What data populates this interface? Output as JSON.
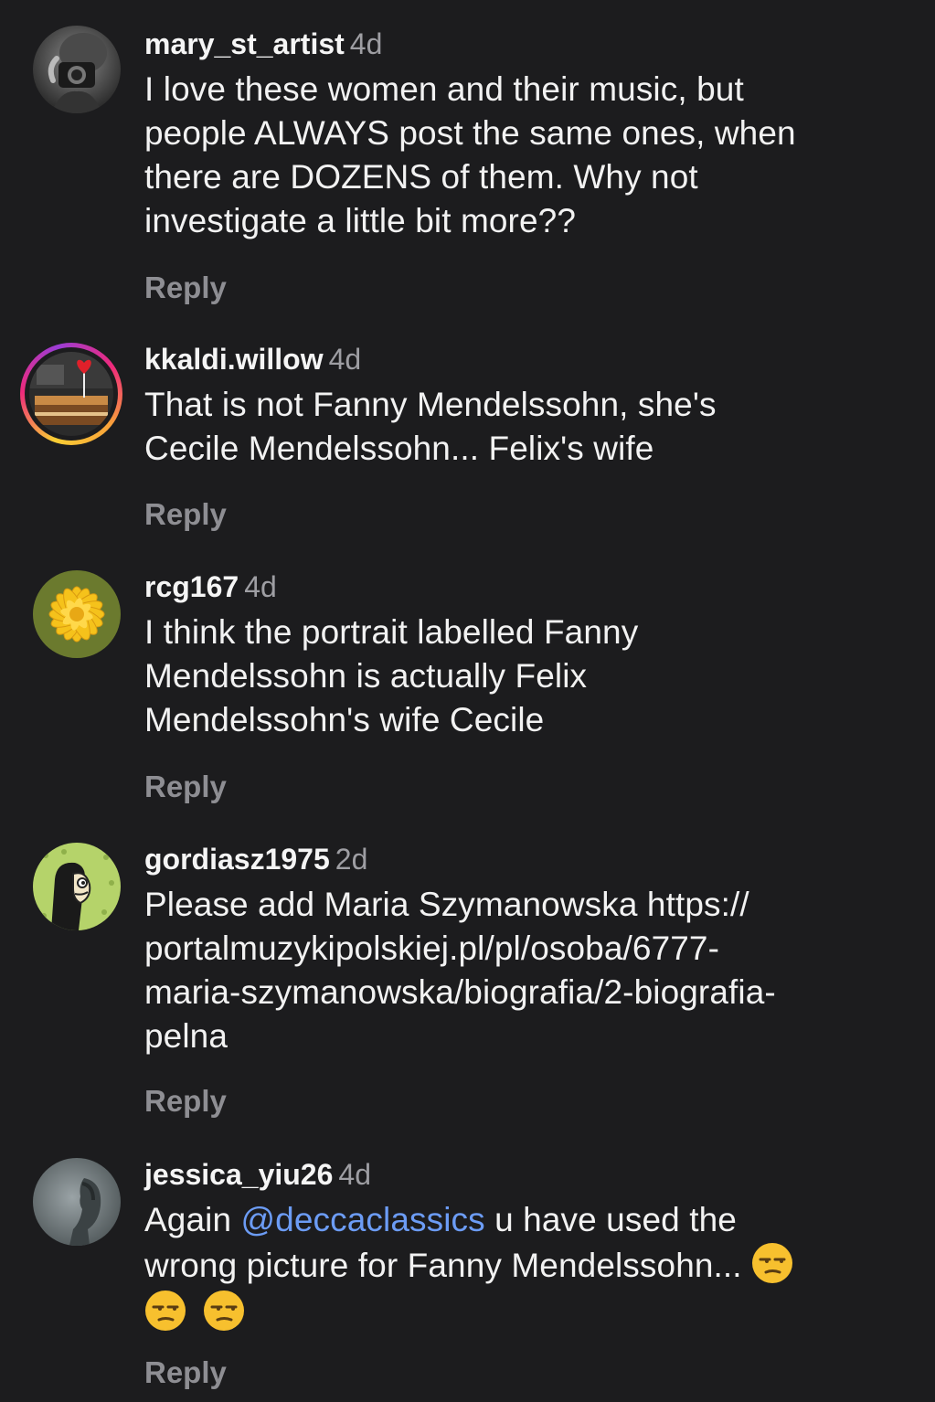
{
  "comments": [
    {
      "username": "mary_st_artist",
      "time": "4d",
      "lines": [
        "I love these women and their music, but",
        "people ALWAYS post the same ones, when",
        "there are DOZENS of them. Why not",
        "investigate a little bit more??"
      ],
      "reply": "Reply",
      "avatar": "camera-portrait"
    },
    {
      "username": "kkaldi.willow",
      "time": "4d",
      "lines": [
        "That is not Fanny Mendelssohn, she's",
        "Cecile Mendelssohn... Felix's wife"
      ],
      "reply": "Reply",
      "avatar": "cake-with-story-ring"
    },
    {
      "username": "rcg167",
      "time": "4d",
      "lines": [
        "I think the portrait labelled Fanny",
        "Mendelssohn is actually Felix",
        "Mendelssohn's wife Cecile"
      ],
      "reply": "Reply",
      "avatar": "yellow-flower"
    },
    {
      "username": "gordiasz1975",
      "time": "2d",
      "lines": [
        "Please add Maria Szymanowska https://",
        "portalmuzykipolskiej.pl/pl/osoba/6777-",
        "maria-szymanowska/biografia/2-biografia-",
        "pelna"
      ],
      "reply": "Reply",
      "avatar": "cartoon-figure"
    },
    {
      "username": "jessica_yiu26",
      "time": "4d",
      "line1_before": "Again ",
      "mention": "@deccaclassics",
      "line1_after": " u have used the",
      "line2": "wrong picture for Fanny Mendelssohn... ",
      "emoji": "unamused-face",
      "reply": "Reply",
      "avatar": "portrait-profile"
    }
  ],
  "colors": {
    "background": "#1c1c1e",
    "text": "#f2f2f2",
    "secondary": "#9e9ea3",
    "mention": "#6c9cf5"
  }
}
